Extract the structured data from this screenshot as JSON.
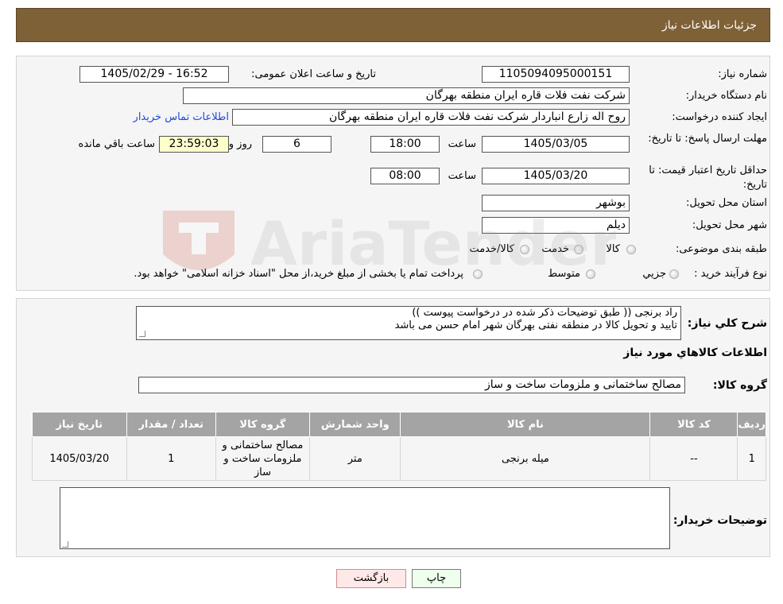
{
  "header": {
    "title": "جزئیات اطلاعات نیاز"
  },
  "form": {
    "need_number_label": "شماره نیاز:",
    "need_number": "1105094095000151",
    "announce_label": "تاریخ و ساعت اعلان عمومی:",
    "announce_value": "1405/02/29 - 16:52",
    "buyer_org_label": "نام دستگاه خریدار:",
    "buyer_org": "شرکت نفت فلات قاره ایران منطقه بهرگان",
    "creator_label": "ایجاد کننده درخواست:",
    "creator": "روح اله زارع انباردار شرکت نفت فلات قاره ایران منطقه بهرگان",
    "contact_link": "اطلاعات تماس خریدار",
    "deadline_label": "مهلت ارسال پاسخ: تا تاریخ:",
    "deadline_date": "1405/03/05",
    "time_label": "ساعت",
    "deadline_time": "18:00",
    "days_value": "6",
    "days_label": "روز و",
    "remaining_value": "23:59:03",
    "remaining_label": "ساعت باقي مانده",
    "validity_label": "حداقل تاریخ اعتبار قیمت: تا تاریخ:",
    "validity_date": "1405/03/20",
    "validity_time": "08:00",
    "province_label": "استان محل تحویل:",
    "province": "بوشهر",
    "city_label": "شهر محل تحویل:",
    "city": "دیلم",
    "category_label": "طبقه بندی موضوعی:",
    "category_options": [
      "کالا",
      "خدمت",
      "کالا/خدمت"
    ],
    "process_label": "نوع فرآیند خرید :",
    "process_options": [
      "جزیي",
      "متوسط"
    ],
    "process_note": "پرداخت تمام یا بخشی از مبلغ خرید،از محل \"اسناد خزانه اسلامی\" خواهد بود."
  },
  "description": {
    "label": "شرح کلي نياز:",
    "line1": "راد برنجی (( طبق توضیحات ذکر شده در درخواست پیوست ))",
    "line2": "تایید و تحویل کالا در منطقه نفتی بهرگان شهر امام حسن می باشد"
  },
  "goods": {
    "section_title": "اطلاعات کالاهاي مورد نياز",
    "group_label": "گروه کالا:",
    "group_value": "مصالح ساختمانی و ملزومات ساخت و ساز",
    "columns": [
      "ردیف",
      "کد کالا",
      "نام کالا",
      "واحد شمارش",
      "گروه کالا",
      "تعداد / مقدار",
      "تاریخ نیاز"
    ],
    "rows": [
      [
        "1",
        "--",
        "میله برنجی",
        "متر",
        "مصالح ساختمانی و ملزومات ساخت و ساز",
        "1",
        "1405/03/20"
      ]
    ]
  },
  "buyer_notes": {
    "label": "توضیحات خریدار:",
    "value": ""
  },
  "buttons": {
    "print": "چاپ",
    "back": "بازگشت"
  },
  "watermark": {
    "text": "AriaTender.neT"
  }
}
